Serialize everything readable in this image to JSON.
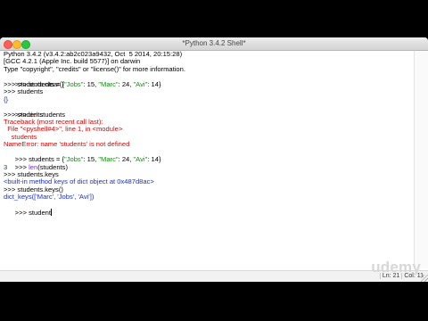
{
  "window": {
    "title": "*Python 3.4.2 Shell*"
  },
  "shell": {
    "lines": [
      "Python 3.4.2 (v3.4.2:ab2c023a9432, Oct  5 2014, 20:15:28)",
      "[GCC 4.2.1 (Apple Inc. build 5577)] on darwin",
      "Type \"copyright\", \"credits\" or \"license()\" for more information.",
      ">>> students = {\"Jobs\": 15, \"Marc\": 24, \"Avi\": 14}",
      ">>> students.clear()",
      ">>> students",
      "{}",
      ">>> del students",
      ">>> students",
      "Traceback (most recent call last):",
      "  File \"<pyshell#4>\", line 1, in <module>",
      "    students",
      "NameError: name 'students' is not defined",
      ">>> students = {\"Jobs\": 15, \"Marc\": 24, \"Avi\": 14}",
      ">>> len(students)",
      "3",
      ">>> students.keys",
      "<built-in method keys of dict object at 0x487d8ac>",
      ">>> students.keys()",
      "dict_keys(['Marc', 'Jobs', 'Avi'])",
      ">>> student"
    ]
  },
  "status": {
    "line": "Ln: 21",
    "col": "Col: 11"
  },
  "watermark": "udemy",
  "colors": {
    "string": "#0a8f0a",
    "keyword": "#e2421f",
    "builtin": "#7a2fd0",
    "error": "#e00000",
    "output": "#1a2fd0"
  }
}
